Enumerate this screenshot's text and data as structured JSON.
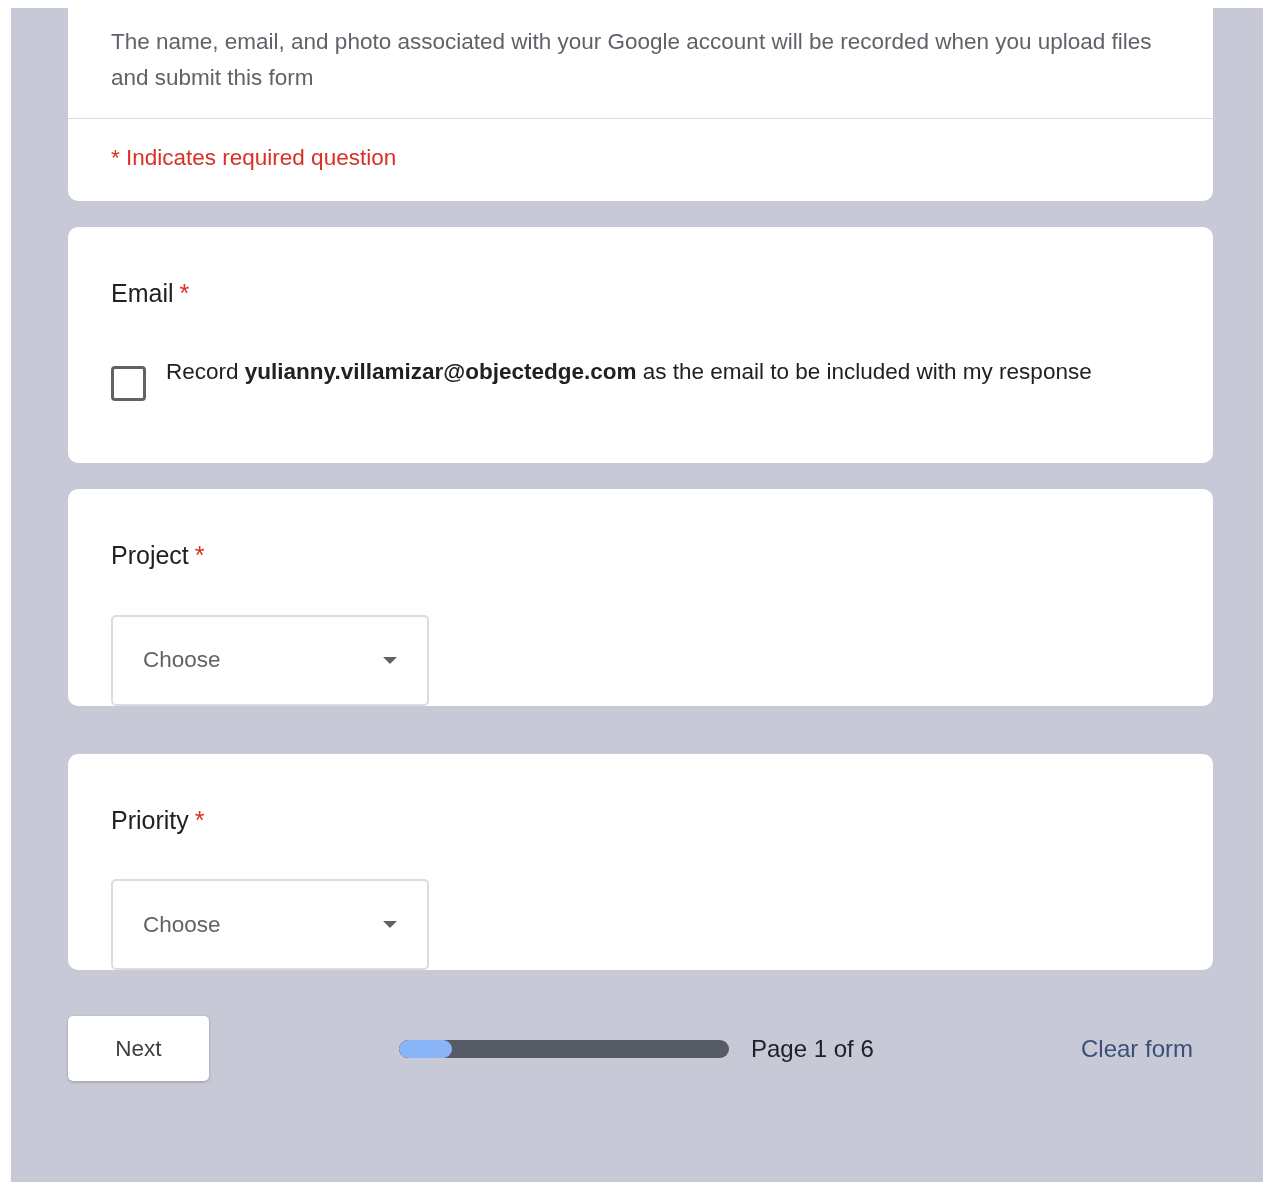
{
  "header_card": {
    "notice": "The name, email, and photo associated with your Google account will be recorded when you upload files and submit this form",
    "required_note": "* Indicates required question"
  },
  "questions": [
    {
      "kind": "checkbox",
      "title": "Email",
      "required_mark": "*",
      "checked": false,
      "label": "Record **yulianny.villamizar@objectedge.com** as the email to be included with my response"
    },
    {
      "kind": "dropdown",
      "title": "Project",
      "required_mark": "*",
      "placeholder": "Choose"
    },
    {
      "kind": "dropdown",
      "title": "Priority",
      "required_mark": "*",
      "placeholder": "Choose"
    }
  ],
  "footer": {
    "next_button": "Next",
    "progress": {
      "level": 0.16
    },
    "page_label": "Page 1 of 6",
    "clear_button": "Clear form"
  }
}
